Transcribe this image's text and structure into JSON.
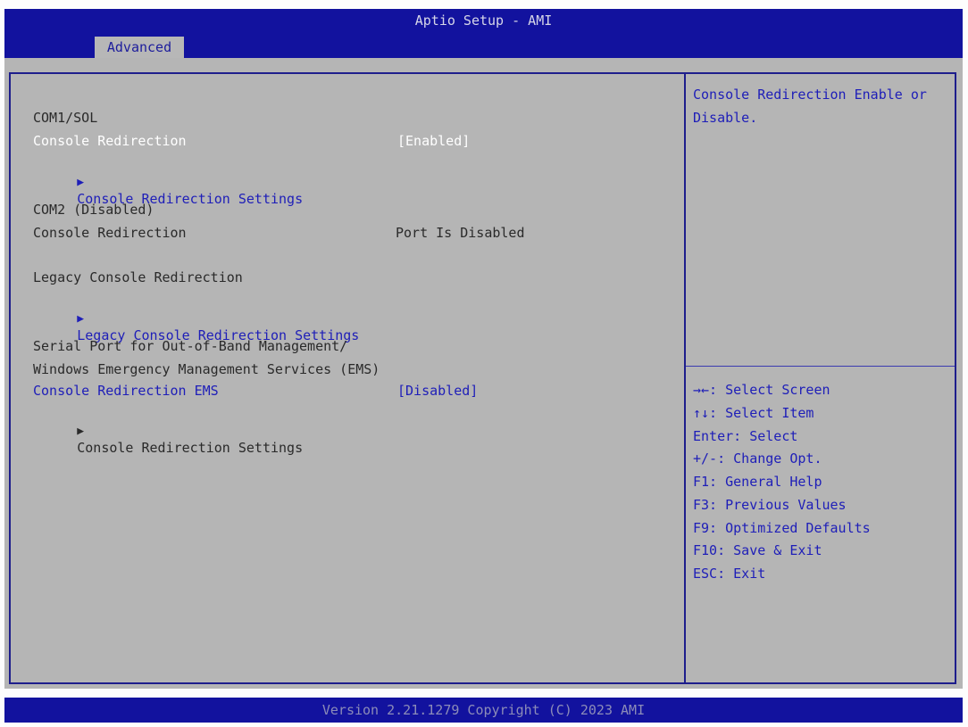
{
  "header": {
    "title": "Aptio Setup - AMI",
    "tab": "Advanced"
  },
  "main": {
    "items": [
      {
        "id": "com1",
        "label": "COM1/SOL"
      },
      {
        "id": "console_redirection_1",
        "label": "Console Redirection",
        "value": "[Enabled]"
      },
      {
        "id": "console_redirection_settings_1",
        "label": "Console Redirection Settings"
      },
      {
        "id": "com2",
        "label": "COM2 (Disabled)"
      },
      {
        "id": "console_redirection_2",
        "label": "Console Redirection",
        "value": "Port Is Disabled"
      },
      {
        "id": "legacy_console_redirection",
        "label": "Legacy Console Redirection"
      },
      {
        "id": "legacy_console_redirection_settings",
        "label": "Legacy Console Redirection Settings"
      },
      {
        "id": "serial_port_line1",
        "label": "Serial Port for Out-of-Band Management/"
      },
      {
        "id": "serial_port_line2",
        "label": "Windows Emergency Management Services (EMS)"
      },
      {
        "id": "console_redirection_ems",
        "label": "Console Redirection EMS",
        "value": "[Disabled]"
      },
      {
        "id": "console_redirection_settings_2",
        "label": "Console Redirection Settings"
      }
    ]
  },
  "help": {
    "description": "Console Redirection Enable or Disable.",
    "keys": [
      "→←: Select Screen",
      "↑↓: Select Item",
      "Enter: Select",
      "+/-: Change Opt.",
      "F1: General Help",
      "F3: Previous Values",
      "F9: Optimized Defaults",
      "F10: Save & Exit",
      "ESC: Exit"
    ]
  },
  "footer": {
    "version": "Version 2.21.1279 Copyright (C) 2023 AMI"
  },
  "colors": {
    "header_bg": "#12129e",
    "panel_bg": "#b5b5b5",
    "highlight_text": "#ffffff",
    "link_text": "#1e1eb8"
  }
}
